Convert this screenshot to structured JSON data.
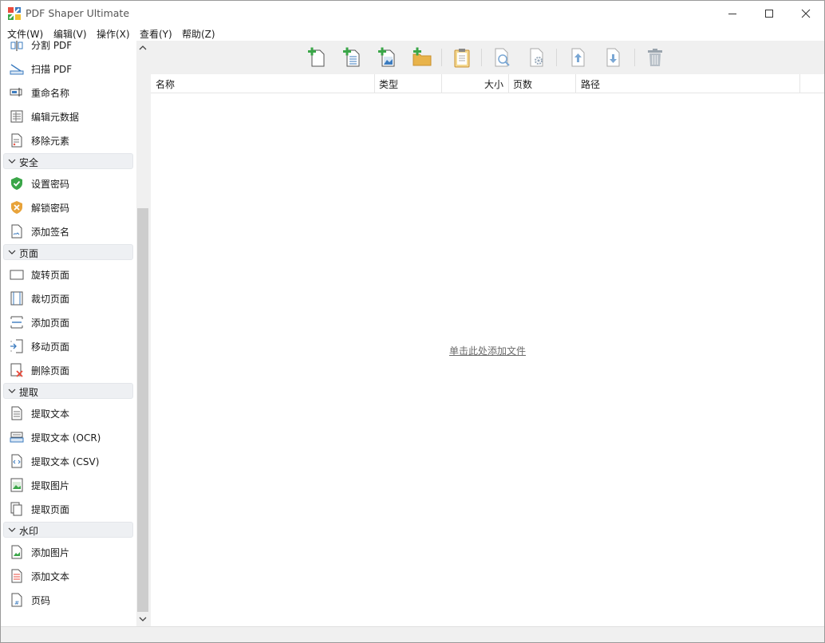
{
  "window": {
    "title": "PDF Shaper Ultimate",
    "controls": [
      "minimize",
      "maximize",
      "close"
    ]
  },
  "menubar": {
    "items": [
      "文件(W)",
      "编辑(V)",
      "操作(X)",
      "查看(Y)",
      "帮助(Z)"
    ]
  },
  "sidebar": {
    "items": [
      {
        "type": "item",
        "label": "分割 PDF",
        "icon": "split-icon"
      },
      {
        "type": "item",
        "label": "扫描 PDF",
        "icon": "scanner-icon"
      },
      {
        "type": "item",
        "label": "重命名称",
        "icon": "rename-icon"
      },
      {
        "type": "item",
        "label": "编辑元数据",
        "icon": "metadata-icon"
      },
      {
        "type": "item",
        "label": "移除元素",
        "icon": "remove-elements-icon"
      },
      {
        "type": "section",
        "label": "安全"
      },
      {
        "type": "item",
        "label": "设置密码",
        "icon": "shield-check-icon"
      },
      {
        "type": "item",
        "label": "解锁密码",
        "icon": "shield-x-icon"
      },
      {
        "type": "item",
        "label": "添加签名",
        "icon": "signature-icon"
      },
      {
        "type": "section",
        "label": "页面"
      },
      {
        "type": "item",
        "label": "旋转页面",
        "icon": "rotate-page-icon"
      },
      {
        "type": "item",
        "label": "裁切页面",
        "icon": "crop-page-icon"
      },
      {
        "type": "item",
        "label": "添加页面",
        "icon": "add-page-icon"
      },
      {
        "type": "item",
        "label": "移动页面",
        "icon": "move-page-icon"
      },
      {
        "type": "item",
        "label": "删除页面",
        "icon": "delete-page-icon"
      },
      {
        "type": "section",
        "label": "提取"
      },
      {
        "type": "item",
        "label": "提取文本",
        "icon": "text-doc-icon"
      },
      {
        "type": "item",
        "label": "提取文本 (OCR)",
        "icon": "ocr-icon"
      },
      {
        "type": "item",
        "label": "提取文本 (CSV)",
        "icon": "csv-icon"
      },
      {
        "type": "item",
        "label": "提取图片",
        "icon": "image-icon"
      },
      {
        "type": "item",
        "label": "提取页面",
        "icon": "pages-icon"
      },
      {
        "type": "section",
        "label": "水印"
      },
      {
        "type": "item",
        "label": "添加图片",
        "icon": "watermark-image-icon"
      },
      {
        "type": "item",
        "label": "添加文本",
        "icon": "watermark-text-icon"
      },
      {
        "type": "item",
        "label": "页码",
        "icon": "page-number-icon"
      }
    ]
  },
  "toolbar": {
    "buttons": [
      {
        "icon": "add-file-icon"
      },
      {
        "icon": "add-text-file-icon"
      },
      {
        "icon": "add-image-file-icon"
      },
      {
        "icon": "add-folder-icon"
      },
      {
        "icon": "clipboard-icon"
      },
      {
        "icon": "preview-icon"
      },
      {
        "icon": "properties-icon"
      },
      {
        "icon": "move-up-icon"
      },
      {
        "icon": "move-down-icon"
      },
      {
        "icon": "delete-icon"
      }
    ]
  },
  "list": {
    "columns": [
      "名称",
      "类型",
      "大小",
      "页数",
      "路径"
    ],
    "empty_link": "单击此处添加文件"
  },
  "colors": {
    "accent_green": "#3aa648",
    "accent_orange": "#e8a33a",
    "accent_blue": "#3b7bbf",
    "link_gray": "#6a6a6a"
  }
}
